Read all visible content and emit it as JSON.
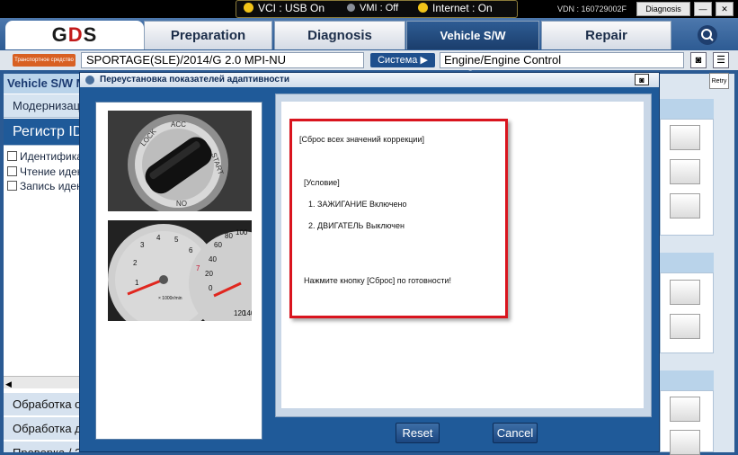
{
  "status_bar": {
    "vci": "VCI : USB On",
    "vmi": "VMI : Off",
    "internet": "Internet : On",
    "vdn": "VDN : 160729002F",
    "finish_label": "Diagnosis Finish",
    "minimize_label": "—",
    "close_label": "✕",
    "colors": {
      "vci_led": "#f2c418",
      "vmi_led": "#8a8f99",
      "internet_led": "#f2c418"
    }
  },
  "nav": {
    "logo": {
      "prefix": "G",
      "accent": "D",
      "suffix": "S"
    },
    "tabs": [
      "Preparation",
      "Diagnosis",
      "Vehicle S/W Management",
      "Repair"
    ],
    "active_tab": "Vehicle S/W Management",
    "search_icon": "search-icon"
  },
  "vehicle": {
    "orange_button": "Транспортное средство",
    "model": "SPORTAGE(SLE)/2014/G 2.0 MPI-NU",
    "system_button": "Система",
    "system_value": "Engine/Engine Control"
  },
  "left_panel": {
    "header": "Vehicle S/W Management",
    "row1": "Модернизация",
    "selected": "Регистр ID",
    "items": [
      "Идентификация",
      "Чтение идентификатора",
      "Запись идентификатора"
    ],
    "bottom": [
      "Обработка о",
      "Обработка дан",
      "Проверка / З"
    ]
  },
  "right_panel": {
    "retry_label": "Retry"
  },
  "dialog": {
    "title": "Переустановка показателей адаптивности",
    "message": {
      "line1": "[Сброс всех значений коррекции]",
      "condition": "[Условие]",
      "cond1": "1. ЗАЖИГАНИЕ Включено",
      "cond2": "2. ДВИГАТЕЛЬ Выключен",
      "prompt": "Нажмите кнопку [Сброс] по готовности!"
    },
    "reset_label": "Reset",
    "cancel_label": "Cancel",
    "ignition_labels": [
      "LOCK",
      "ACC",
      "START",
      "ON"
    ],
    "gauge_ticks": [
      "1",
      "2",
      "3",
      "4",
      "5",
      "6",
      "7"
    ],
    "speed_ticks": [
      "0",
      "20",
      "40",
      "60",
      "80",
      "100",
      "120",
      "140"
    ],
    "gauge_unit": "× 1000r/min",
    "highlight_color": "#d9141e"
  }
}
